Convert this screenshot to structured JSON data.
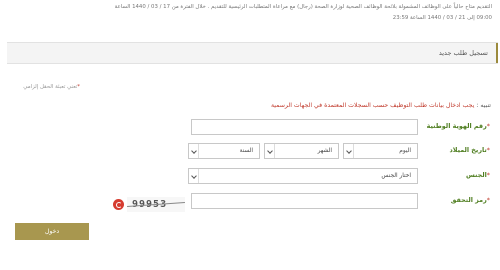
{
  "notice": {
    "line1": "التقديم متاح حالياً على الوظائف المشمولة بلائحة الوظائف الصحية لوزارة الصحة (رجال) مع مراعاة المتطلبات الرئيسية للتقديم . خلال الفترة من 17 / 03 / 1440 الساعة",
    "line2": "09:00 إلى 21 / 03 / 1440 الساعة 23:59"
  },
  "panel": {
    "title": "تسجيل طلب جديد"
  },
  "required_note": {
    "star": "*",
    "text": "تعني تعبئة الحقل إلزامي"
  },
  "warning": {
    "lead": "تنبيه : ",
    "text": "يجب ادخال بيانات طلب التوظيف حسب السجلات المعتمدة في الجهات الرسمية"
  },
  "form": {
    "national_id": {
      "label": "رقم الهوية الوطنية",
      "star": "*",
      "value": ""
    },
    "birth_date": {
      "label": "تاريخ الميلاد",
      "star": "*",
      "day": "اليوم",
      "month": "الشهر",
      "year": "السنة"
    },
    "gender": {
      "label": "الجنس",
      "star": "*",
      "value": "اختار الجنس"
    },
    "captcha": {
      "label": "رمز التحقق",
      "star": "*",
      "image_text": "99953",
      "value": ""
    }
  },
  "submit": {
    "label": "دخول"
  },
  "colors": {
    "accent": "#a8974f",
    "label_green": "#4e7d1f",
    "required_red": "#c0392b"
  }
}
